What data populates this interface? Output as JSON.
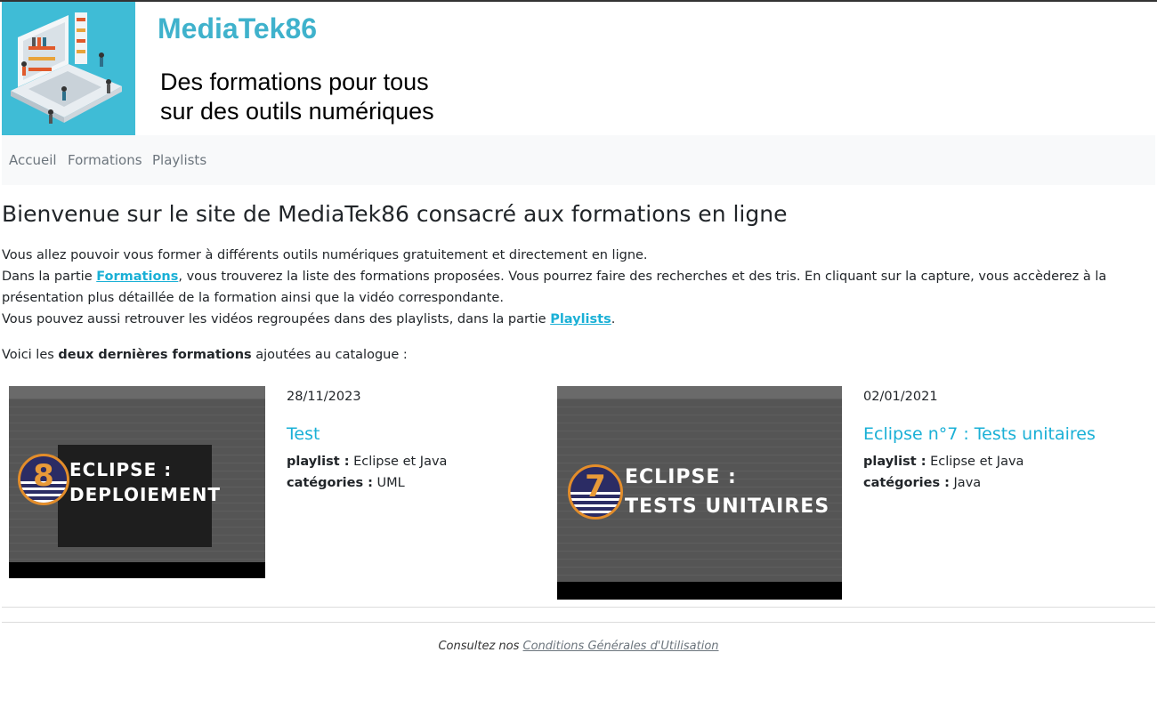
{
  "header": {
    "site_title": "MediaTek86",
    "tagline_line1": "Des formations pour tous",
    "tagline_line2": "sur des outils numériques"
  },
  "nav": {
    "items": [
      {
        "label": "Accueil"
      },
      {
        "label": "Formations"
      },
      {
        "label": "Playlists"
      }
    ]
  },
  "main": {
    "title": "Bienvenue sur le site de MediaTek86 consacré aux formations en ligne",
    "intro_line1": "Vous allez pouvoir vous former à différents outils numériques gratuitement et directement en ligne.",
    "intro_line2_before": "Dans la partie ",
    "intro_line2_link": "Formations",
    "intro_line2_after": ", vous trouverez la liste des formations proposées. Vous pourrez faire des recherches et des tris. En cliquant sur la capture, vous accèderez à la présentation plus détaillée de la formation ainsi que la vidéo correspondante.",
    "intro_line3_before": "Vous pouvez aussi retrouver les vidéos regroupées dans des playlists, dans la partie ",
    "intro_line3_link": "Playlists",
    "intro_line3_after": ".",
    "latest_before": "Voici les ",
    "latest_bold": "deux dernières formations",
    "latest_after": " ajoutées au catalogue :"
  },
  "formations": [
    {
      "thumb_number": "8",
      "thumb_line1": "ECLIPSE :",
      "thumb_line2": "DEPLOIEMENT",
      "date": "28/11/2023",
      "title": "Test",
      "playlist_label": "playlist :",
      "playlist": "Eclipse et Java",
      "categories_label": "catégories :",
      "categories": "UML"
    },
    {
      "thumb_number": "7",
      "thumb_line1": "ECLIPSE :",
      "thumb_line2": "TESTS UNITAIRES",
      "date": "02/01/2021",
      "title": "Eclipse n°7 : Tests unitaires",
      "playlist_label": "playlist :",
      "playlist": "Eclipse et Java",
      "categories_label": "catégories :",
      "categories": "Java"
    }
  ],
  "footer": {
    "text_before": "Consultez nos ",
    "link": "Conditions Générales d'Utilisation"
  },
  "colors": {
    "brand": "#3fb2cc",
    "link": "#1ab0d6",
    "logo_bg": "#3fbcd6"
  }
}
